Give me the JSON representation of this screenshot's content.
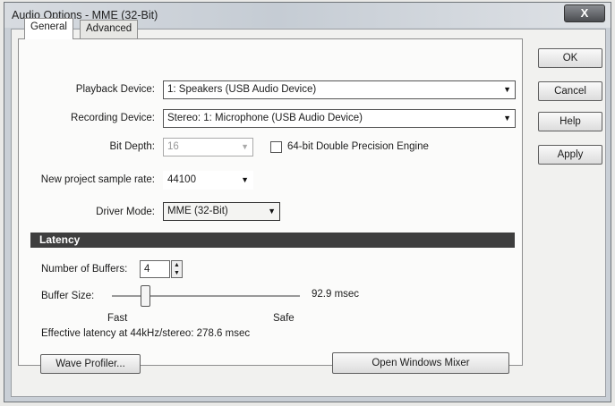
{
  "window": {
    "title": "Audio Options - MME (32-Bit)",
    "close_glyph": "X"
  },
  "tabs": [
    {
      "label": "General"
    },
    {
      "label": "Advanced"
    }
  ],
  "general": {
    "playback_label": "Playback Device:",
    "playback_value": "1: Speakers (USB Audio Device)",
    "recording_label": "Recording Device:",
    "recording_value": "Stereo: 1: Microphone (USB Audio Device)",
    "bitdepth_label": "Bit Depth:",
    "bitdepth_value": "16",
    "double_precision_label": "64-bit Double Precision Engine",
    "double_precision_checked": false,
    "sample_rate_label": "New project sample rate:",
    "sample_rate_value": "44100",
    "driver_label": "Driver Mode:",
    "driver_value": "MME (32-Bit)"
  },
  "latency": {
    "header": "Latency",
    "buffers_label": "Number of Buffers:",
    "buffers_value": "4",
    "buffer_size_label": "Buffer Size:",
    "buffer_size_value": "92.9 msec",
    "buffer_size_slider_fraction": 0.18,
    "fast_label": "Fast",
    "safe_label": "Safe",
    "effective_text": "Effective latency at 44kHz/stereo:  278.6 msec",
    "wave_profiler_label": "Wave Profiler...",
    "open_mixer_label": "Open Windows Mixer"
  },
  "buttons": {
    "ok": "OK",
    "cancel": "Cancel",
    "help": "Help",
    "apply": "Apply"
  }
}
